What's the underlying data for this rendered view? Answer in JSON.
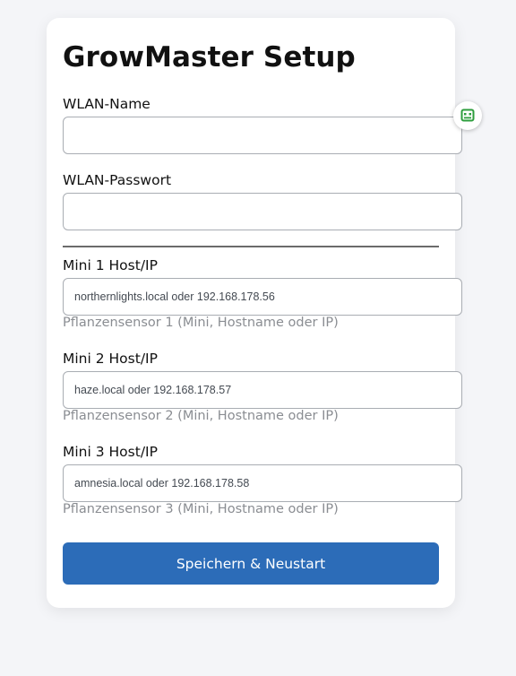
{
  "page": {
    "title": "GrowMaster Setup"
  },
  "wifi": {
    "ssid_label": "WLAN-Name",
    "ssid_value": "",
    "password_label": "WLAN-Passwort",
    "password_value": ""
  },
  "minis": [
    {
      "label": "Mini 1 Host/IP",
      "placeholder": "northernlights.local oder 192.168.178.56",
      "hint": "Pflanzensensor 1 (Mini, Hostname oder IP)"
    },
    {
      "label": "Mini 2 Host/IP",
      "placeholder": "haze.local oder 192.168.178.57",
      "hint": "Pflanzensensor 2 (Mini, Hostname oder IP)"
    },
    {
      "label": "Mini 3 Host/IP",
      "placeholder": "amnesia.local oder 192.168.178.58",
      "hint": "Pflanzensensor 3 (Mini, Hostname oder IP)"
    }
  ],
  "actions": {
    "save_label": "Speichern & Neustart"
  },
  "extension": {
    "icon": "password-manager-icon",
    "accent": "#2e9e3e"
  },
  "colors": {
    "button": "#2c6cb8",
    "hint": "#8a8d92"
  }
}
